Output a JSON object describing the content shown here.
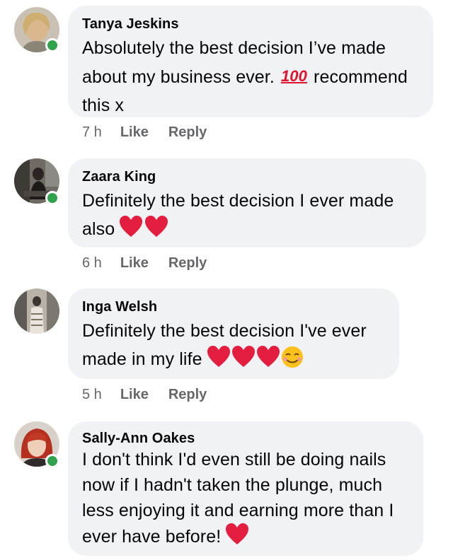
{
  "comments": [
    {
      "author": "Tanya Jeskins",
      "text_a": "Absolutely the best decision I’ve made",
      "text_b": "about my business ever.",
      "hundred": "100",
      "text_c": "recommend",
      "text_d": "this x",
      "time": "7 h",
      "like": "Like",
      "reply": "Reply",
      "online": true
    },
    {
      "author": "Zaara King",
      "text_a": "Definitely the best decision I ever made",
      "text_b": "also",
      "time": "6 h",
      "like": "Like",
      "reply": "Reply",
      "online": true
    },
    {
      "author": "Inga Welsh",
      "text_a": "Definitely the best decision I've ever",
      "text_b": "made in my life",
      "time": "5 h",
      "like": "Like",
      "reply": "Reply",
      "online": false
    },
    {
      "author": "Sally-Ann Oakes",
      "lines": [
        "I don't think I'd even still be doing nails",
        "now if I hadn't taken the plunge, much",
        "less enjoying it and earning more than I",
        "ever have before!"
      ],
      "online": true
    }
  ],
  "colors": {
    "bubble": "#f0f2f5",
    "online": "#31a24c",
    "meta": "#65676b",
    "heart": "#e41e3f"
  },
  "icons": [
    "heart-emoji-icon",
    "hundred-points-emoji-icon",
    "smiling-face-emoji-icon",
    "online-status-icon"
  ]
}
